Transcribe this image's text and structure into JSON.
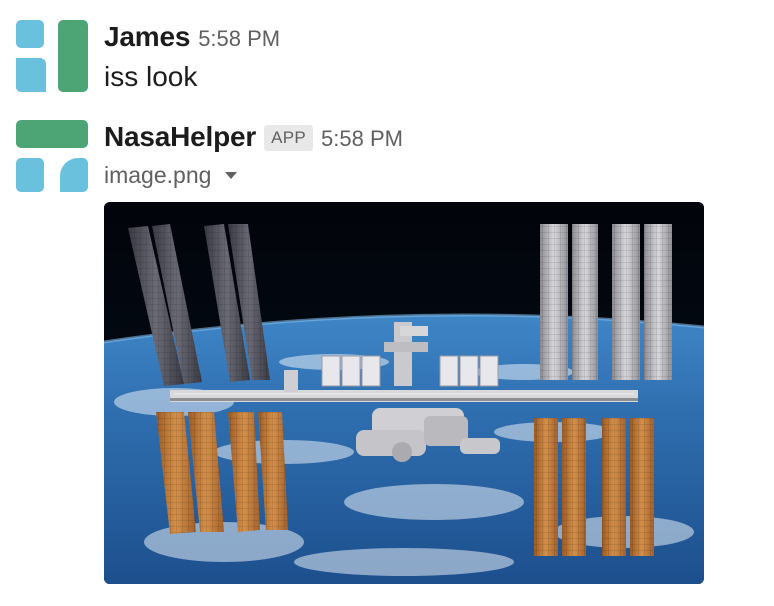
{
  "messages": [
    {
      "sender": "James",
      "time": "5:58 PM",
      "text": "iss look",
      "avatar_icon": "workspace-logo-avatar"
    },
    {
      "sender": "NasaHelper",
      "badge": "APP",
      "time": "5:58 PM",
      "attachment": {
        "file_name": "image.png",
        "menu_icon": "caret-down-icon",
        "image_subject": "iss-photo"
      },
      "avatar_icon": "workspace-logo-avatar"
    }
  ],
  "colors": {
    "avatar_blue": "#6ac1de",
    "avatar_green": "#4da575",
    "text_primary": "#1d1c1d",
    "text_secondary": "#616061",
    "badge_bg": "#e8e8e8"
  }
}
